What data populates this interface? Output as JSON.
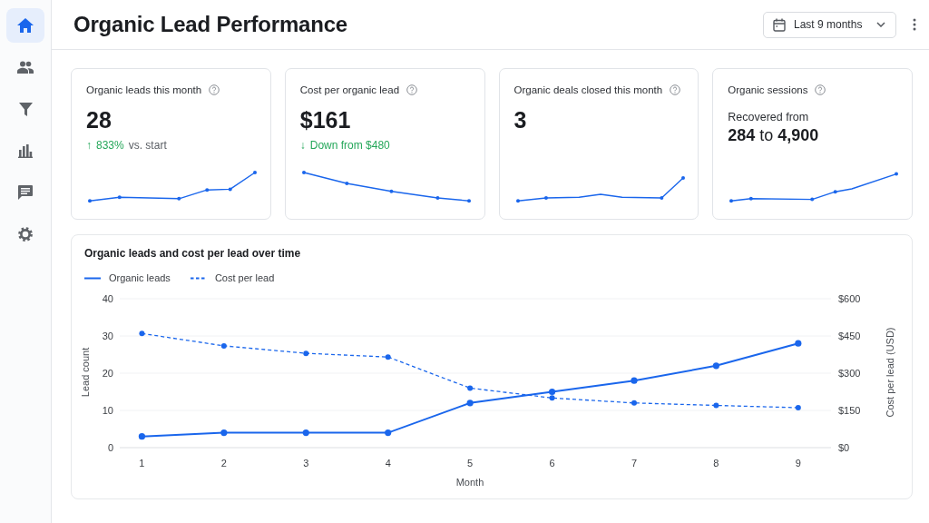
{
  "sidebar": {
    "items": [
      {
        "selected": true
      },
      {
        "selected": false
      },
      {
        "selected": false
      },
      {
        "selected": false
      },
      {
        "selected": false
      },
      {
        "selected": false
      }
    ]
  },
  "header": {
    "title": "Organic Lead Performance",
    "date_range": "Last 9 months"
  },
  "cards": [
    {
      "kind": "stat",
      "title": "Organic leads this month",
      "value": "28",
      "delta": {
        "arrow": "↑",
        "text": "833%",
        "note": "vs. start"
      }
    },
    {
      "kind": "stat",
      "title": "Cost per organic lead",
      "value": "$161",
      "delta": {
        "arrow": "↓",
        "text": "Down from $480"
      }
    },
    {
      "kind": "stat",
      "title": "Organic deals closed this month",
      "value": "3"
    },
    {
      "kind": "range",
      "title": "Organic sessions",
      "caption": "Recovered from",
      "value": "**284** to **4,900**"
    }
  ],
  "chart": {
    "chart_data": {
      "type": "line",
      "title": "Organic leads and cost per lead over time",
      "xlabel": "Month",
      "ylabel": "Lead count",
      "x": [
        1,
        2,
        3,
        4,
        5,
        6,
        7,
        8,
        9
      ],
      "series": [
        {
          "name": "Organic leads",
          "color": "#1a66ec",
          "line_style": "solid",
          "marker": "circle",
          "values": [
            3,
            4,
            4,
            4,
            12,
            15,
            18,
            22,
            28
          ]
        },
        {
          "name": "Cost per lead",
          "color": "#1a66ec",
          "axis": "y2",
          "line_style": "dashed",
          "marker": "circle",
          "values": [
            460,
            410,
            380,
            365,
            240,
            200,
            180,
            170,
            161
          ]
        }
      ],
      "grid": true,
      "xlim": [
        0.73,
        9.4
      ],
      "xticks": [
        1,
        2,
        3,
        4,
        5,
        6,
        7,
        8,
        9
      ],
      "ylim": [
        0,
        40
      ],
      "yticks": [
        0,
        10,
        20,
        30,
        40
      ],
      "y2label": "Cost per lead (USD)",
      "y2lim": [
        0,
        600
      ],
      "y2ticks": [
        {
          "value": 0,
          "label": "$0"
        },
        {
          "value": 150,
          "label": "$150"
        },
        {
          "value": 300,
          "label": "$300"
        },
        {
          "value": 450,
          "label": "$450"
        },
        {
          "value": 600,
          "label": "$600"
        }
      ]
    }
  }
}
